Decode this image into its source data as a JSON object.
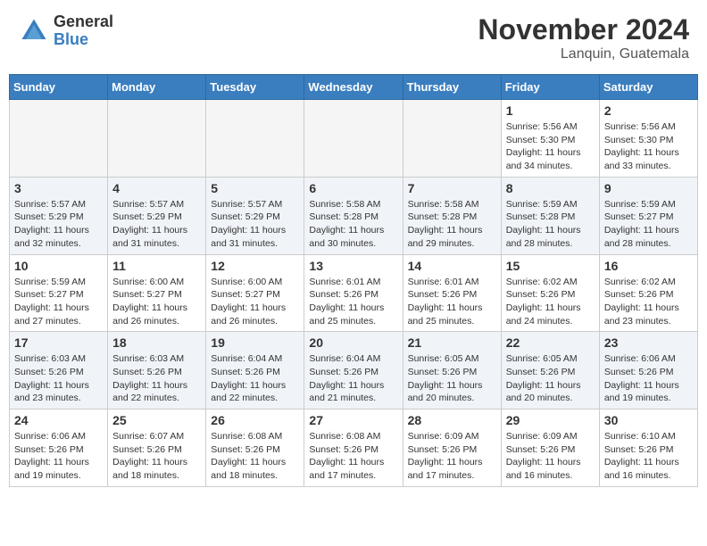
{
  "header": {
    "logo": {
      "general": "General",
      "blue": "Blue"
    },
    "title": "November 2024",
    "location": "Lanquin, Guatemala"
  },
  "calendar": {
    "days_of_week": [
      "Sunday",
      "Monday",
      "Tuesday",
      "Wednesday",
      "Thursday",
      "Friday",
      "Saturday"
    ],
    "weeks": [
      {
        "alt": false,
        "days": [
          {
            "num": "",
            "empty": true
          },
          {
            "num": "",
            "empty": true
          },
          {
            "num": "",
            "empty": true
          },
          {
            "num": "",
            "empty": true
          },
          {
            "num": "",
            "empty": true
          },
          {
            "num": "1",
            "sunrise": "Sunrise: 5:56 AM",
            "sunset": "Sunset: 5:30 PM",
            "daylight": "Daylight: 11 hours and 34 minutes."
          },
          {
            "num": "2",
            "sunrise": "Sunrise: 5:56 AM",
            "sunset": "Sunset: 5:30 PM",
            "daylight": "Daylight: 11 hours and 33 minutes."
          }
        ]
      },
      {
        "alt": true,
        "days": [
          {
            "num": "3",
            "sunrise": "Sunrise: 5:57 AM",
            "sunset": "Sunset: 5:29 PM",
            "daylight": "Daylight: 11 hours and 32 minutes."
          },
          {
            "num": "4",
            "sunrise": "Sunrise: 5:57 AM",
            "sunset": "Sunset: 5:29 PM",
            "daylight": "Daylight: 11 hours and 31 minutes."
          },
          {
            "num": "5",
            "sunrise": "Sunrise: 5:57 AM",
            "sunset": "Sunset: 5:29 PM",
            "daylight": "Daylight: 11 hours and 31 minutes."
          },
          {
            "num": "6",
            "sunrise": "Sunrise: 5:58 AM",
            "sunset": "Sunset: 5:28 PM",
            "daylight": "Daylight: 11 hours and 30 minutes."
          },
          {
            "num": "7",
            "sunrise": "Sunrise: 5:58 AM",
            "sunset": "Sunset: 5:28 PM",
            "daylight": "Daylight: 11 hours and 29 minutes."
          },
          {
            "num": "8",
            "sunrise": "Sunrise: 5:59 AM",
            "sunset": "Sunset: 5:28 PM",
            "daylight": "Daylight: 11 hours and 28 minutes."
          },
          {
            "num": "9",
            "sunrise": "Sunrise: 5:59 AM",
            "sunset": "Sunset: 5:27 PM",
            "daylight": "Daylight: 11 hours and 28 minutes."
          }
        ]
      },
      {
        "alt": false,
        "days": [
          {
            "num": "10",
            "sunrise": "Sunrise: 5:59 AM",
            "sunset": "Sunset: 5:27 PM",
            "daylight": "Daylight: 11 hours and 27 minutes."
          },
          {
            "num": "11",
            "sunrise": "Sunrise: 6:00 AM",
            "sunset": "Sunset: 5:27 PM",
            "daylight": "Daylight: 11 hours and 26 minutes."
          },
          {
            "num": "12",
            "sunrise": "Sunrise: 6:00 AM",
            "sunset": "Sunset: 5:27 PM",
            "daylight": "Daylight: 11 hours and 26 minutes."
          },
          {
            "num": "13",
            "sunrise": "Sunrise: 6:01 AM",
            "sunset": "Sunset: 5:26 PM",
            "daylight": "Daylight: 11 hours and 25 minutes."
          },
          {
            "num": "14",
            "sunrise": "Sunrise: 6:01 AM",
            "sunset": "Sunset: 5:26 PM",
            "daylight": "Daylight: 11 hours and 25 minutes."
          },
          {
            "num": "15",
            "sunrise": "Sunrise: 6:02 AM",
            "sunset": "Sunset: 5:26 PM",
            "daylight": "Daylight: 11 hours and 24 minutes."
          },
          {
            "num": "16",
            "sunrise": "Sunrise: 6:02 AM",
            "sunset": "Sunset: 5:26 PM",
            "daylight": "Daylight: 11 hours and 23 minutes."
          }
        ]
      },
      {
        "alt": true,
        "days": [
          {
            "num": "17",
            "sunrise": "Sunrise: 6:03 AM",
            "sunset": "Sunset: 5:26 PM",
            "daylight": "Daylight: 11 hours and 23 minutes."
          },
          {
            "num": "18",
            "sunrise": "Sunrise: 6:03 AM",
            "sunset": "Sunset: 5:26 PM",
            "daylight": "Daylight: 11 hours and 22 minutes."
          },
          {
            "num": "19",
            "sunrise": "Sunrise: 6:04 AM",
            "sunset": "Sunset: 5:26 PM",
            "daylight": "Daylight: 11 hours and 22 minutes."
          },
          {
            "num": "20",
            "sunrise": "Sunrise: 6:04 AM",
            "sunset": "Sunset: 5:26 PM",
            "daylight": "Daylight: 11 hours and 21 minutes."
          },
          {
            "num": "21",
            "sunrise": "Sunrise: 6:05 AM",
            "sunset": "Sunset: 5:26 PM",
            "daylight": "Daylight: 11 hours and 20 minutes."
          },
          {
            "num": "22",
            "sunrise": "Sunrise: 6:05 AM",
            "sunset": "Sunset: 5:26 PM",
            "daylight": "Daylight: 11 hours and 20 minutes."
          },
          {
            "num": "23",
            "sunrise": "Sunrise: 6:06 AM",
            "sunset": "Sunset: 5:26 PM",
            "daylight": "Daylight: 11 hours and 19 minutes."
          }
        ]
      },
      {
        "alt": false,
        "days": [
          {
            "num": "24",
            "sunrise": "Sunrise: 6:06 AM",
            "sunset": "Sunset: 5:26 PM",
            "daylight": "Daylight: 11 hours and 19 minutes."
          },
          {
            "num": "25",
            "sunrise": "Sunrise: 6:07 AM",
            "sunset": "Sunset: 5:26 PM",
            "daylight": "Daylight: 11 hours and 18 minutes."
          },
          {
            "num": "26",
            "sunrise": "Sunrise: 6:08 AM",
            "sunset": "Sunset: 5:26 PM",
            "daylight": "Daylight: 11 hours and 18 minutes."
          },
          {
            "num": "27",
            "sunrise": "Sunrise: 6:08 AM",
            "sunset": "Sunset: 5:26 PM",
            "daylight": "Daylight: 11 hours and 17 minutes."
          },
          {
            "num": "28",
            "sunrise": "Sunrise: 6:09 AM",
            "sunset": "Sunset: 5:26 PM",
            "daylight": "Daylight: 11 hours and 17 minutes."
          },
          {
            "num": "29",
            "sunrise": "Sunrise: 6:09 AM",
            "sunset": "Sunset: 5:26 PM",
            "daylight": "Daylight: 11 hours and 16 minutes."
          },
          {
            "num": "30",
            "sunrise": "Sunrise: 6:10 AM",
            "sunset": "Sunset: 5:26 PM",
            "daylight": "Daylight: 11 hours and 16 minutes."
          }
        ]
      }
    ]
  }
}
